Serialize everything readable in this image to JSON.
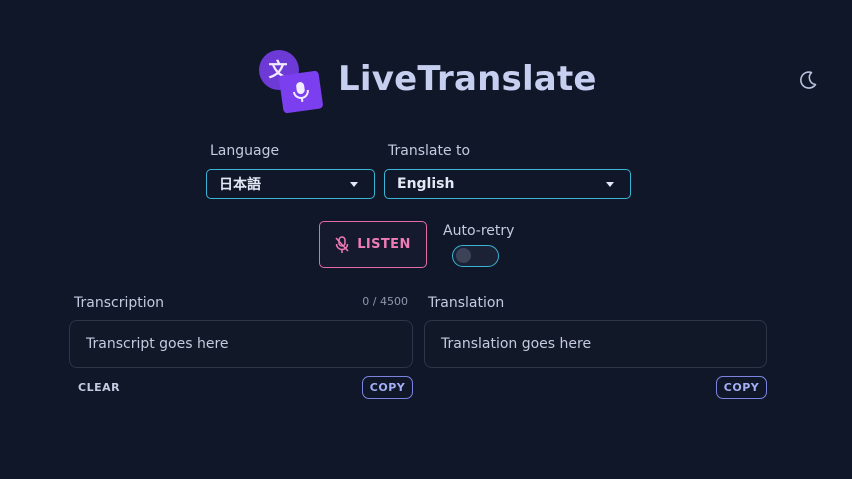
{
  "app": {
    "title": "LiveTranslate",
    "logo_glyph": "文",
    "accent": "#7b3ff0"
  },
  "icons": {
    "theme": "moon-icon",
    "listen": "mic-off-icon",
    "logo_mic": "mic-icon"
  },
  "controls": {
    "language_label": "Language",
    "language_value": "日本語",
    "translate_label": "Translate to",
    "translate_value": "English",
    "listen_label": "LISTEN",
    "auto_retry_label": "Auto-retry",
    "auto_retry_on": false
  },
  "transcription": {
    "label": "Transcription",
    "counter": "0 / 4500",
    "placeholder": "Transcript goes here",
    "clear_label": "CLEAR",
    "copy_label": "COPY"
  },
  "translation": {
    "label": "Translation",
    "placeholder": "Translation goes here",
    "copy_label": "COPY"
  }
}
